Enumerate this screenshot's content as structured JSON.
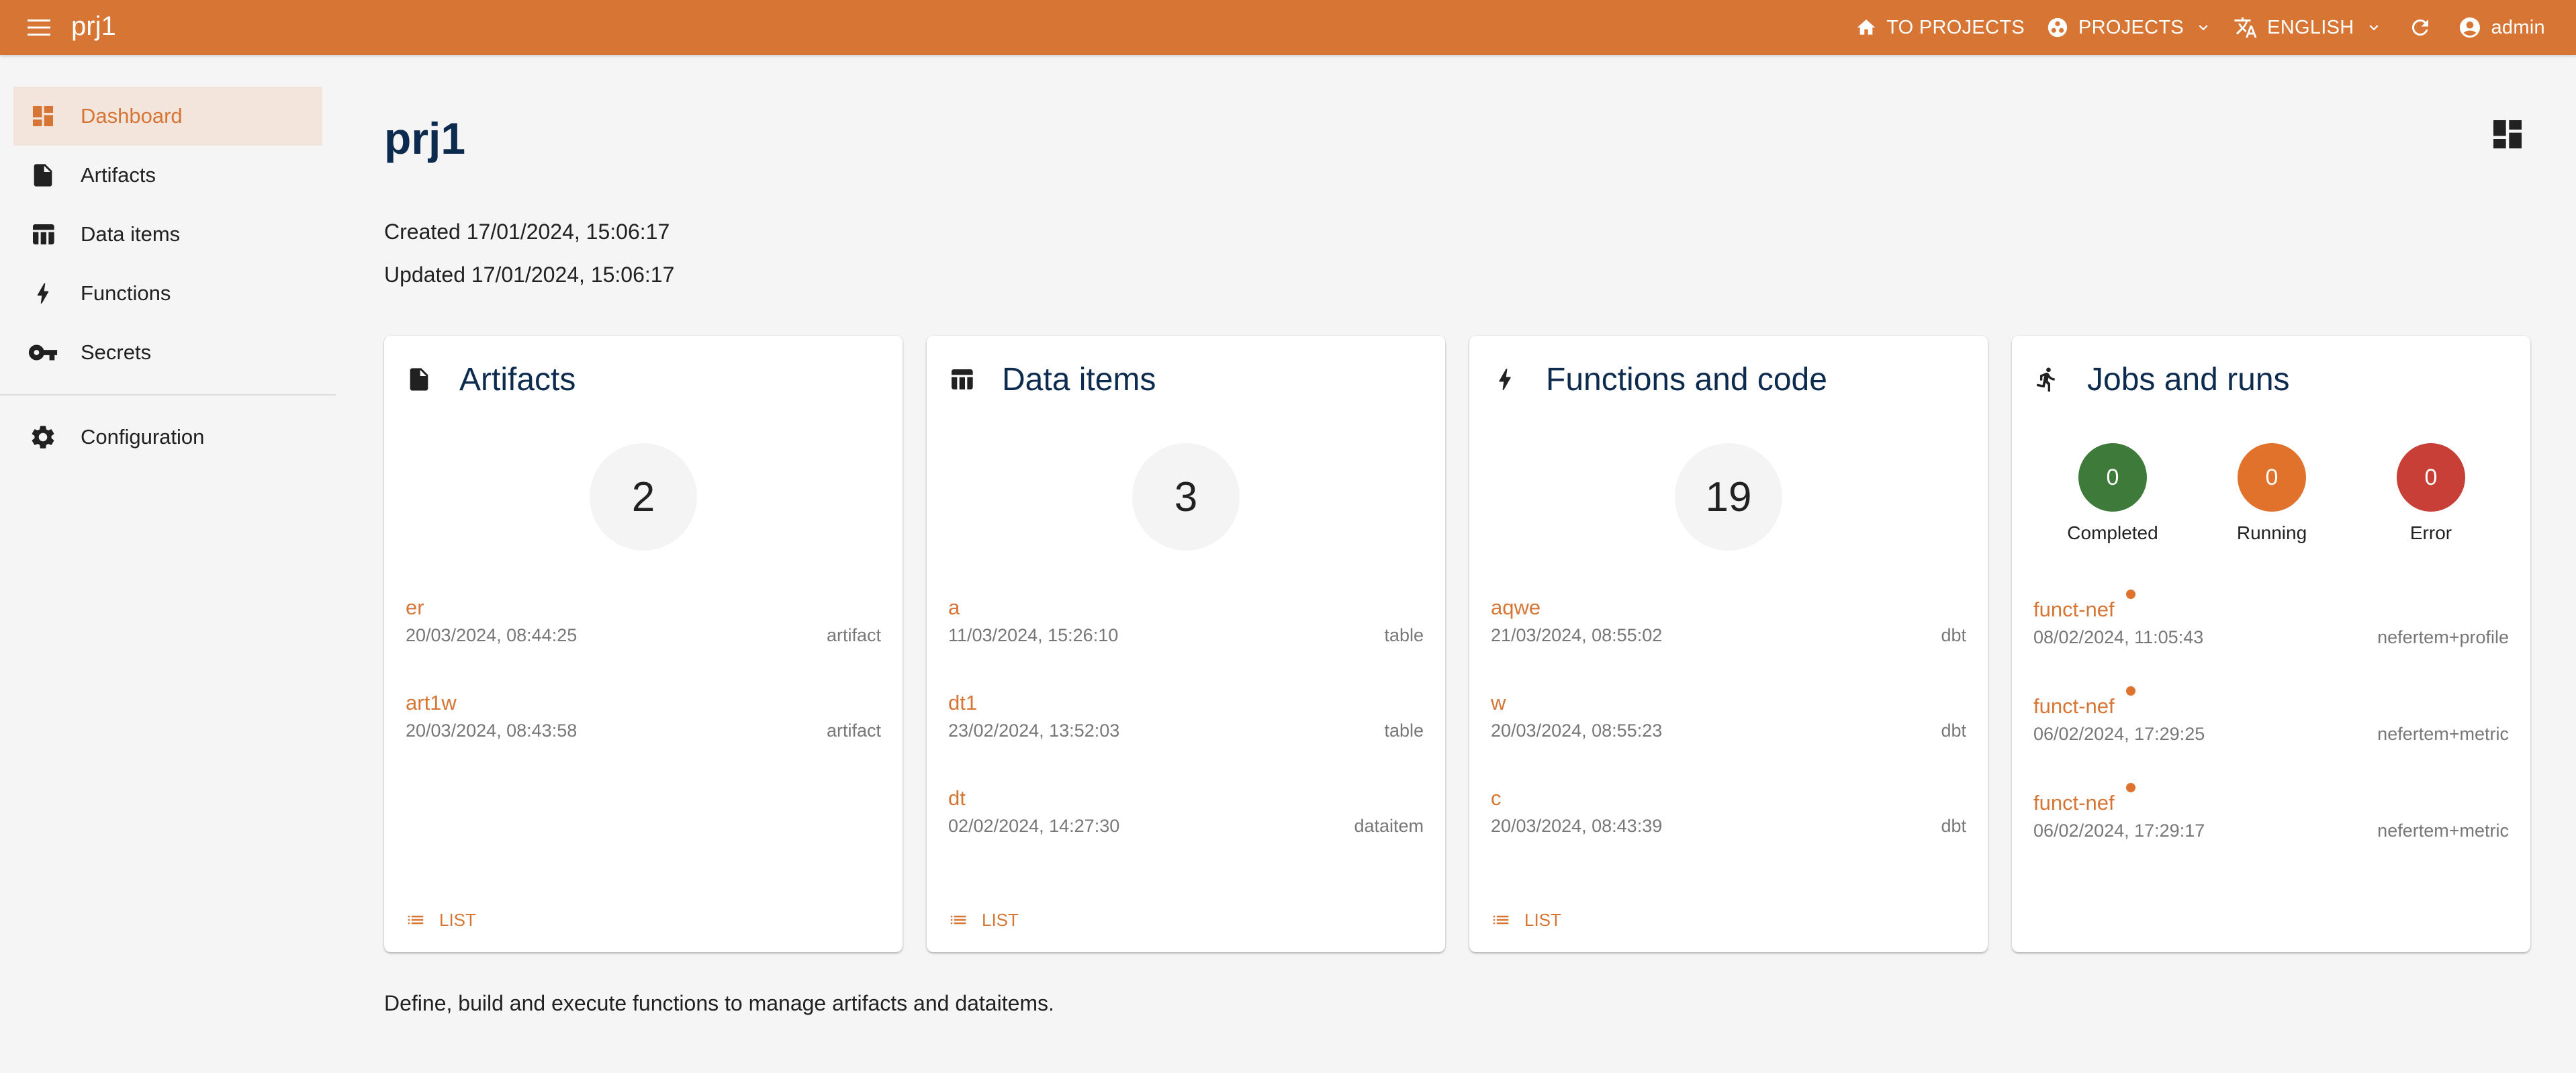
{
  "header": {
    "app_title": "prj1",
    "to_projects_label": "TO PROJECTS",
    "projects_label": "PROJECTS",
    "language_label": "ENGLISH",
    "user_label": "admin",
    "colors": {
      "primary": "#d67534",
      "title": "#0d2b4e"
    }
  },
  "sidebar": {
    "items": [
      {
        "label": "Dashboard",
        "icon": "dashboard-icon",
        "active": true
      },
      {
        "label": "Artifacts",
        "icon": "file-icon"
      },
      {
        "label": "Data items",
        "icon": "table-icon"
      },
      {
        "label": "Functions",
        "icon": "bolt-icon"
      },
      {
        "label": "Secrets",
        "icon": "key-icon"
      },
      {
        "label": "Configuration",
        "icon": "gear-icon"
      }
    ]
  },
  "main": {
    "title": "prj1",
    "created": "Created 17/01/2024, 15:06:17",
    "updated": "Updated 17/01/2024, 15:06:17",
    "footer": "Define, build and execute functions to manage artifacts and dataitems.",
    "cards": {
      "artifacts": {
        "title": "Artifacts",
        "count": "2",
        "list_label": "LIST",
        "items": [
          {
            "name": "er",
            "date": "20/03/2024, 08:44:25",
            "kind": "artifact"
          },
          {
            "name": "art1w",
            "date": "20/03/2024, 08:43:58",
            "kind": "artifact"
          }
        ]
      },
      "dataitems": {
        "title": "Data items",
        "count": "3",
        "list_label": "LIST",
        "items": [
          {
            "name": "a",
            "date": "11/03/2024, 15:26:10",
            "kind": "table"
          },
          {
            "name": "dt1",
            "date": "23/02/2024, 13:52:03",
            "kind": "table"
          },
          {
            "name": "dt",
            "date": "02/02/2024, 14:27:30",
            "kind": "dataitem"
          }
        ]
      },
      "functions": {
        "title": "Functions and code",
        "count": "19",
        "list_label": "LIST",
        "items": [
          {
            "name": "aqwe",
            "date": "21/03/2024, 08:55:02",
            "kind": "dbt"
          },
          {
            "name": "w",
            "date": "20/03/2024, 08:55:23",
            "kind": "dbt"
          },
          {
            "name": "c",
            "date": "20/03/2024, 08:43:39",
            "kind": "dbt"
          }
        ]
      },
      "runs": {
        "title": "Jobs and runs",
        "stats": [
          {
            "label": "Completed",
            "value": "0",
            "color": "#3e7a3a"
          },
          {
            "label": "Running",
            "value": "0",
            "color": "#e0722c"
          },
          {
            "label": "Error",
            "value": "0",
            "color": "#c73f36"
          }
        ],
        "items": [
          {
            "name": "funct-nef",
            "date": "08/02/2024, 11:05:43",
            "kind": "nefertem+profile",
            "status_color": "#e07230"
          },
          {
            "name": "funct-nef",
            "date": "06/02/2024, 17:29:25",
            "kind": "nefertem+metric",
            "status_color": "#e07230"
          },
          {
            "name": "funct-nef",
            "date": "06/02/2024, 17:29:17",
            "kind": "nefertem+metric",
            "status_color": "#e07230"
          }
        ]
      }
    }
  }
}
